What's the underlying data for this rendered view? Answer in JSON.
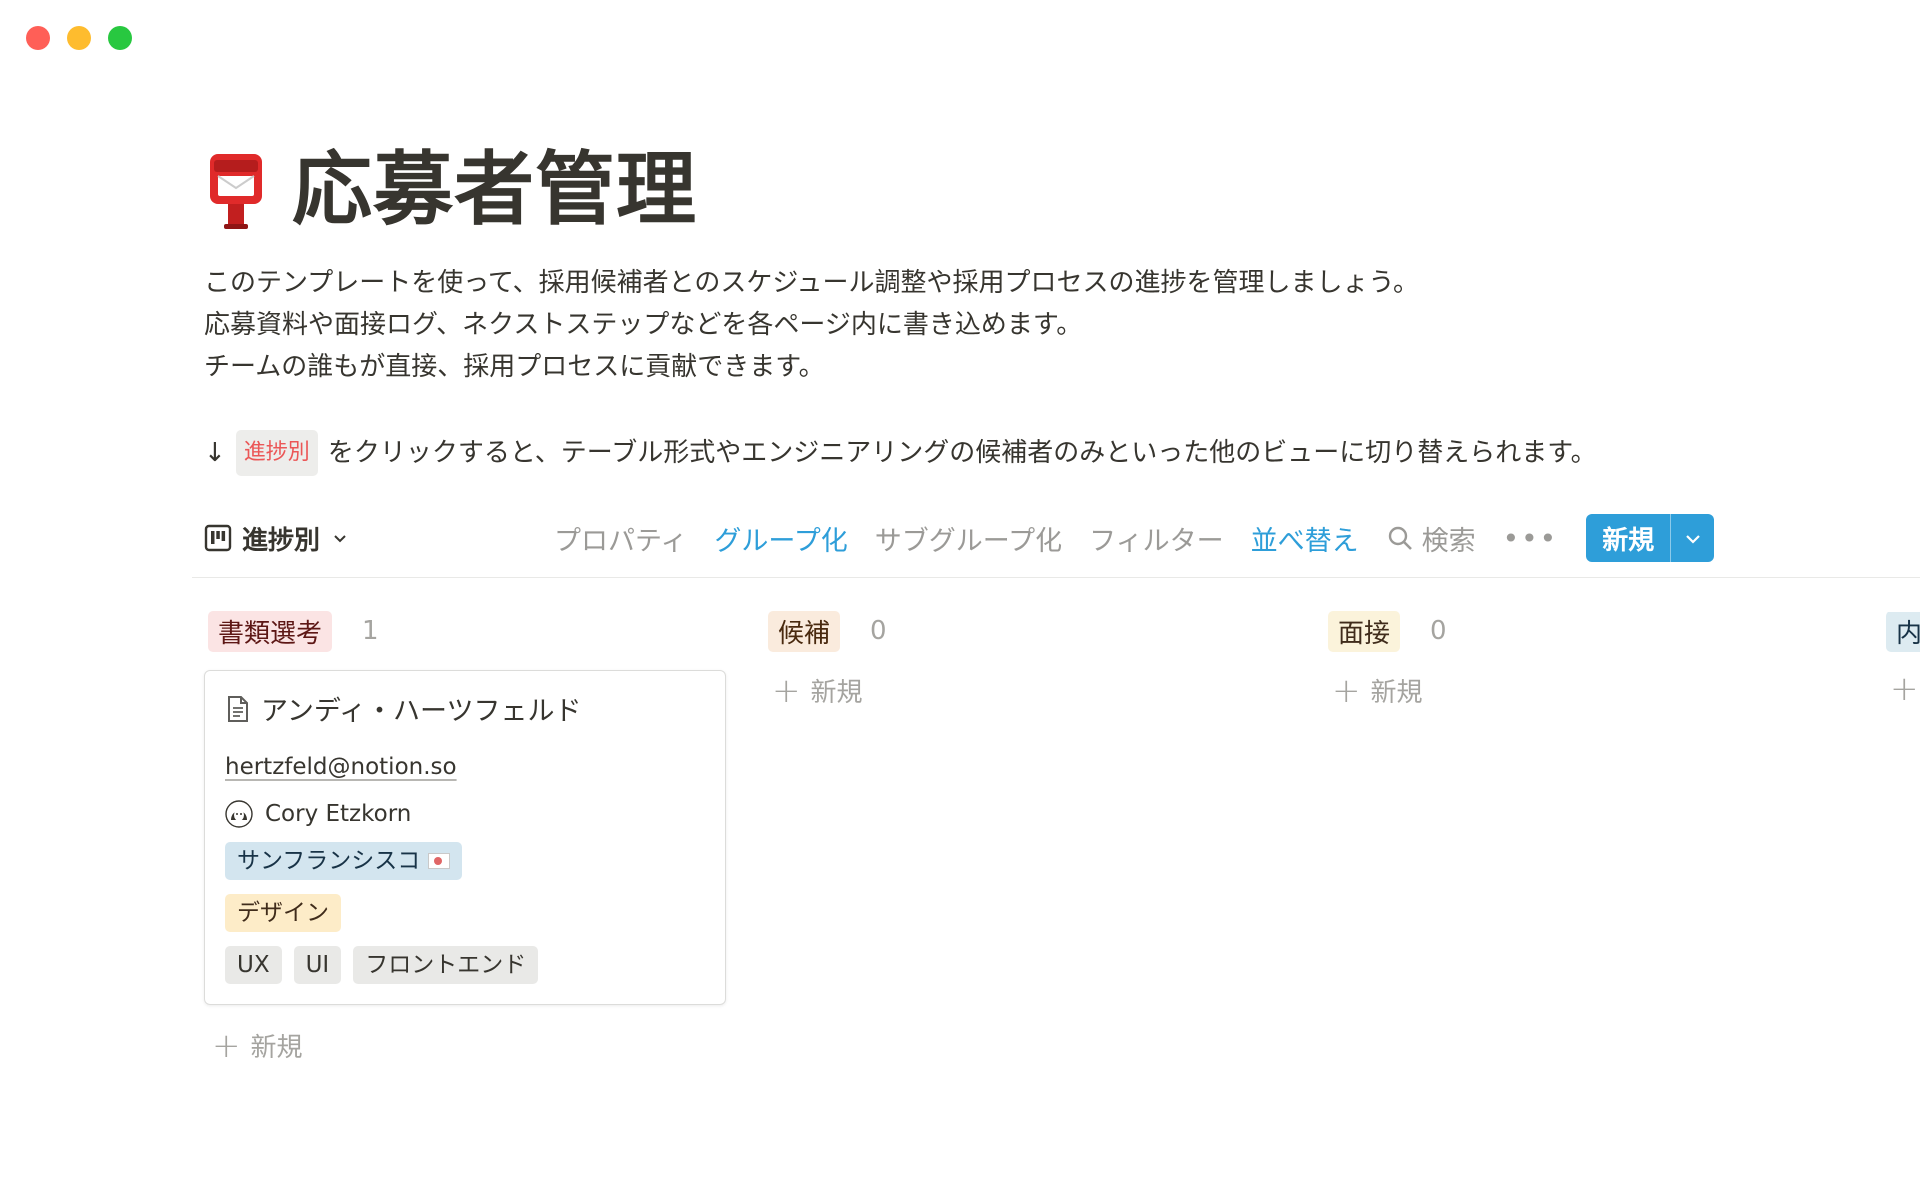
{
  "page": {
    "title": "応募者管理",
    "icon": "postbox-icon",
    "description": [
      "このテンプレートを使って、採用候補者とのスケジュール調整や採用プロセスの進捗を管理しましょう。",
      "応募資料や面接ログ、ネクストステップなどを各ページ内に書き込めます。",
      "チームの誰もが直接、採用プロセスに貢献できます。"
    ],
    "hint": {
      "arrow": "↓",
      "chip": "進捗別",
      "text": "をクリックすると、テーブル形式やエンジニアリングの候補者のみといった他のビューに切り替えられます。"
    }
  },
  "toolbar": {
    "view_label": "進捗別",
    "properties": "プロパティ",
    "group": "グループ化",
    "subgroup": "サブグループ化",
    "filter": "フィルター",
    "sort": "並べ替え",
    "search": "検索",
    "more": "•••",
    "new_button": "新規"
  },
  "board": {
    "add_label": "新規",
    "columns": [
      {
        "name": "書類選考",
        "count": "1",
        "color_bg": "#fbe4e4",
        "color_text": "#5d1715",
        "cards": [
          {
            "title": "アンディ・ハーツフェルド",
            "email": "hertzfeld@notion.so",
            "person": "Cory Etzkorn",
            "location": "サンフランシスコ",
            "team": "デザイン",
            "skills": [
              "UX",
              "UI",
              "フロントエンド"
            ]
          }
        ]
      },
      {
        "name": "候補",
        "count": "0",
        "color_bg": "#faebdd",
        "color_text": "#49290e"
      },
      {
        "name": "面接",
        "count": "0",
        "color_bg": "#fbf3db",
        "color_text": "#402c1b"
      },
      {
        "name": "内",
        "count": "",
        "color_bg": "#ddebf1",
        "color_text": "#183347"
      }
    ]
  },
  "colors": {
    "accent": "#2e9ed9",
    "location_tag_bg": "#d3e5ef",
    "team_tag_bg": "#fdecc8",
    "skill_tag_bg": "#e9e9e7"
  }
}
